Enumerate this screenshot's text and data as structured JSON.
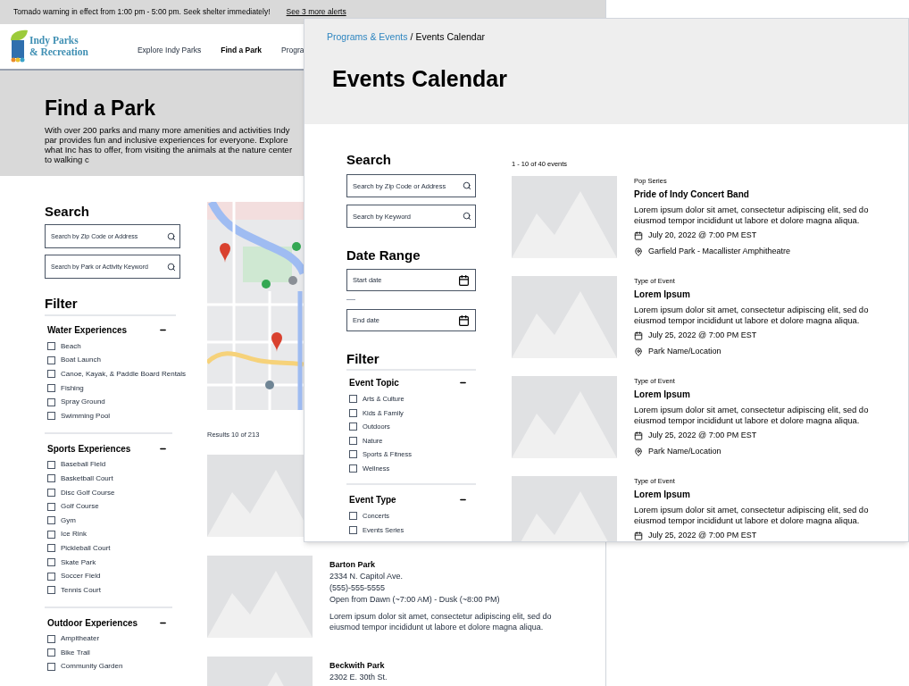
{
  "alert": {
    "message": "Tornado warning in effect from 1:00 pm - 5:00 pm. Seek shelter immediately!",
    "link": "See 3 more alerts"
  },
  "logo": {
    "line1": "Indy Parks",
    "line2": "& Recreation"
  },
  "nav": [
    {
      "label": "Explore Indy Parks",
      "selected": false
    },
    {
      "label": "Find a Park",
      "selected": true
    },
    {
      "label": "Progra",
      "selected": false
    }
  ],
  "hero": {
    "title": "Find a Park",
    "text": "With over 200 parks and many more amenities and activities Indy par provides fun and inclusive experiences for everyone. Explore what Inc has to offer, from visiting the animals at the nature center to walking c"
  },
  "search": {
    "heading": "Search",
    "fields": [
      {
        "placeholder": "Search by Zip Code or Address"
      },
      {
        "placeholder": "Search by Park or Activity Keyword"
      }
    ]
  },
  "filter": {
    "heading": "Filter",
    "groups": [
      {
        "title": "Water Experiences",
        "expanded": true,
        "options": [
          {
            "label": "Beach",
            "checked": false
          },
          {
            "label": "Boat Launch",
            "checked": false
          },
          {
            "label": "Canoe, Kayak, & Paddle Board Rentals",
            "checked": false
          },
          {
            "label": "Fishing",
            "checked": false
          },
          {
            "label": "Spray Ground",
            "checked": false
          },
          {
            "label": "Swimming Pool",
            "checked": false
          }
        ]
      },
      {
        "title": "Sports Experiences",
        "expanded": true,
        "options": [
          {
            "label": "Baseball Field",
            "checked": false
          },
          {
            "label": "Basketball Court",
            "checked": false
          },
          {
            "label": "Disc Golf Course",
            "checked": false
          },
          {
            "label": "Golf Course",
            "checked": false
          },
          {
            "label": "Gym",
            "checked": false
          },
          {
            "label": "Ice Rink",
            "checked": false
          },
          {
            "label": "Pickleball Court",
            "checked": false
          },
          {
            "label": "Skate Park",
            "checked": false
          },
          {
            "label": "Soccer Field",
            "checked": false
          },
          {
            "label": "Tennis Court",
            "checked": false
          }
        ]
      },
      {
        "title": "Outdoor Experiences",
        "expanded": true,
        "options": [
          {
            "label": "Ampitheater",
            "checked": false
          },
          {
            "label": "Bike Trail",
            "checked": false
          },
          {
            "label": "Community Garden",
            "checked": false
          }
        ]
      }
    ]
  },
  "results": {
    "count": "Results 10 of 213",
    "parks": [
      {
        "photo": true
      },
      {
        "photo": true,
        "name": "Barton Park",
        "address": "2334 N. Capitol Ave.",
        "phone": "(555)-555-5555",
        "hours": "Open from Dawn (~7:00 AM) - Dusk (~8:00 PM)",
        "description": "Lorem ipsum dolor sit amet, consectetur adipiscing elit, sed do eiusmod tempor incididunt ut labore et dolore magna aliqua."
      },
      {
        "photo": true,
        "name": "Beckwith Park",
        "address": "2302 E. 30th St."
      }
    ]
  },
  "events_page": {
    "breadcrumb": {
      "link": "Programs & Events",
      "separator": "/",
      "current": "Events Calendar"
    },
    "title": "Events Calendar",
    "search": {
      "heading": "Search",
      "fields": [
        {
          "placeholder": "Search by Zip Code or Address"
        },
        {
          "placeholder": "Search by Keyword"
        }
      ]
    },
    "date_range": {
      "heading": "Date Range",
      "start": {
        "placeholder": "Start date"
      },
      "end": {
        "placeholder": "End date"
      }
    },
    "filter": {
      "heading": "Filter",
      "groups": [
        {
          "title": "Event Topic",
          "expanded": true,
          "options": [
            {
              "label": "Arts & Culture",
              "checked": false
            },
            {
              "label": "Kids & Family",
              "checked": false
            },
            {
              "label": "Outdoors",
              "checked": false
            },
            {
              "label": "Nature",
              "checked": false
            },
            {
              "label": "Sports & Fitness",
              "checked": false
            },
            {
              "label": "Wellness",
              "checked": false
            }
          ]
        },
        {
          "title": "Event Type",
          "expanded": true,
          "options": [
            {
              "label": "Concerts",
              "checked": false
            },
            {
              "label": "Events Series",
              "checked": false
            }
          ]
        }
      ]
    },
    "count": "1 - 10 of 40 events",
    "events": [
      {
        "type": "Pop Series",
        "title": "Pride of Indy Concert Band",
        "description": "Lorem ipsum dolor sit amet, consectetur adipiscing elit, sed do eiusmod tempor incididunt ut labore et dolore magna aliqua.",
        "date": "July 20, 2022 @ 7:00 PM EST",
        "location": "Garfield Park - Macallister Amphitheatre"
      },
      {
        "type": "Type of Event",
        "title": "Lorem Ipsum",
        "description": "Lorem ipsum dolor sit amet, consectetur adipiscing elit, sed do eiusmod tempor incididunt ut labore et dolore magna aliqua.",
        "date": "July 25, 2022 @ 7:00 PM EST",
        "location": "Park Name/Location"
      },
      {
        "type": "Type of Event",
        "title": "Lorem Ipsum",
        "description": "Lorem ipsum dolor sit amet, consectetur adipiscing elit, sed do eiusmod tempor incididunt ut labore et dolore magna aliqua.",
        "date": "July 25, 2022 @ 7:00 PM EST",
        "location": "Park Name/Location"
      },
      {
        "type": "Type of Event",
        "title": "Lorem Ipsum",
        "description": "Lorem ipsum dolor sit amet, consectetur adipiscing elit, sed do eiusmod tempor incididunt ut labore et dolore magna aliqua.",
        "date": "July 25, 2022 @ 7:00 PM EST"
      }
    ]
  }
}
